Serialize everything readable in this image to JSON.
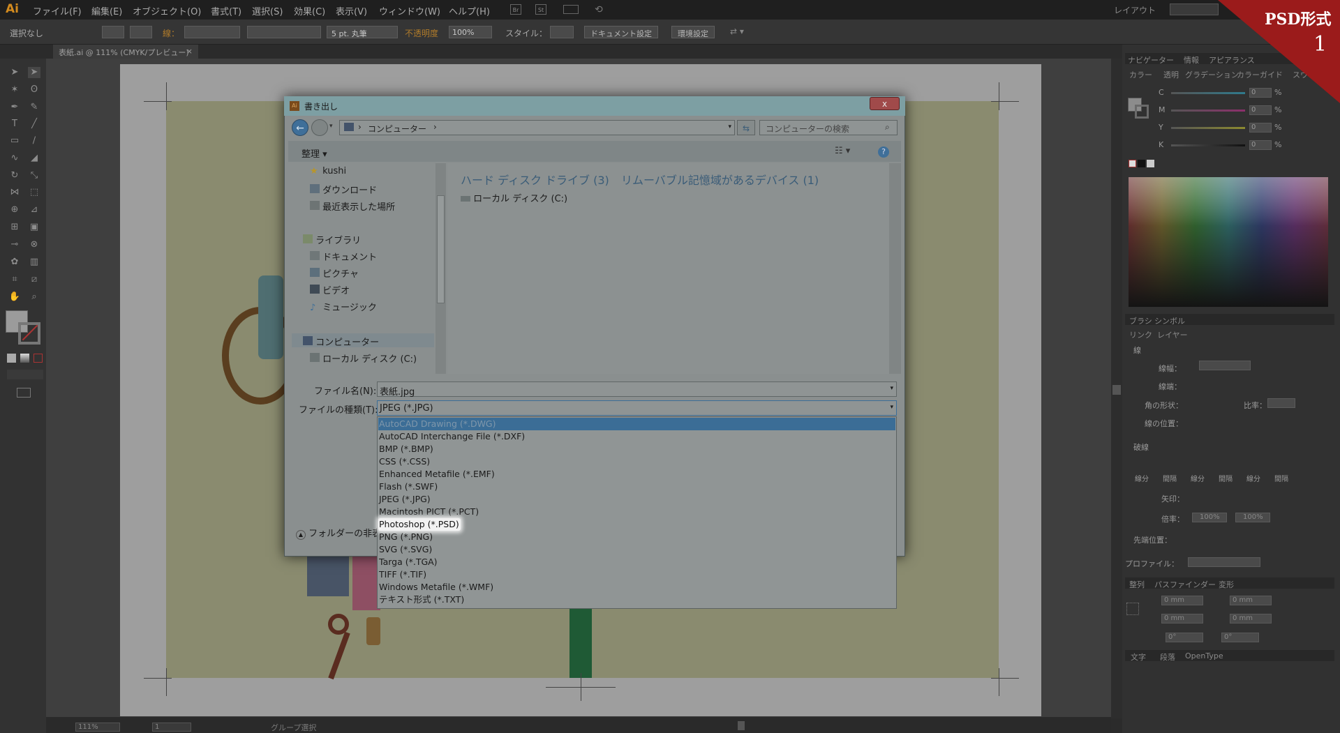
{
  "app": {
    "logo": "Ai",
    "menu": [
      "ファイル(F)",
      "編集(E)",
      "オブジェクト(O)",
      "書式(T)",
      "選択(S)",
      "効果(C)",
      "表示(V)",
      "ウィンドウ(W)",
      "ヘルプ(H)"
    ],
    "bridge_buttons": [
      "Br",
      "St"
    ],
    "workspace": "レイアウト",
    "search_placeholder": ""
  },
  "control_bar": {
    "selection": "選択なし",
    "stroke_label": "線：",
    "brush": "5 pt. 丸筆",
    "opacity_label": "不透明度",
    "opacity_value": "100%",
    "style_label": "スタイル：",
    "document_settings": "ドキュメント設定",
    "preferences": "環境設定"
  },
  "doc_tab": {
    "title": "表紙.ai @ 111% (CMYK/プレビュー)",
    "close": "×"
  },
  "status_bar": {
    "zoom": "111%",
    "page": "1",
    "tool": "グループ選択"
  },
  "corner_badge": {
    "title": "PSD形式",
    "step": "1",
    "color": "#9b1b1b"
  },
  "right_panel": {
    "tabs_top": [
      "ナビゲーター",
      "情報",
      "アピアランス"
    ],
    "tabs_color": [
      "カラー",
      "透明",
      "グラデーション",
      "カラーガイド",
      "スウォッチ"
    ],
    "cmyk": [
      {
        "label": "C",
        "value": "0",
        "unit": "%"
      },
      {
        "label": "M",
        "value": "0",
        "unit": "%"
      },
      {
        "label": "Y",
        "value": "0",
        "unit": "%"
      },
      {
        "label": "K",
        "value": "0",
        "unit": "%"
      }
    ],
    "tabs_brush": [
      "ブラシ",
      "シンボル"
    ],
    "tabs_layers": [
      "リンク",
      "レイヤー"
    ],
    "stroke_title": "線",
    "stroke_rows": [
      "線幅：",
      "線端：",
      "角の形状：",
      "線の位置："
    ],
    "miter_label": "比率：",
    "dash_title": "破線",
    "dash_labels": [
      "線分",
      "間隔",
      "線分",
      "間隔",
      "線分",
      "間隔"
    ],
    "arrow_label": "矢印：",
    "scale_label": "倍率：",
    "scale_values": [
      "100%",
      "100%"
    ],
    "align_label": "先端位置：",
    "profile_label": "プロファイル：",
    "tabs_transform": [
      "整列",
      "パスファインダー",
      "変形"
    ],
    "transform": {
      "x": "0 mm",
      "y": "0 mm",
      "w": "0 mm",
      "h": "0 mm",
      "angle": "0°",
      "shear": "0°"
    },
    "tabs_type": [
      "文字",
      "段落",
      "OpenType"
    ]
  },
  "dialog": {
    "title": "書き出し",
    "close": "x",
    "address": "コンピューター",
    "search_placeholder": "コンピューターの検索",
    "organize": "整理",
    "nav": {
      "favorites": [
        "kushi",
        "ダウンロード",
        "最近表示した場所"
      ],
      "library_title": "ライブラリ",
      "libraries": [
        "ドキュメント",
        "ピクチャ",
        "ビデオ",
        "ミュージック"
      ],
      "computer_title": "コンピューター",
      "drives": [
        "ローカル ディスク (C:)"
      ]
    },
    "groups": [
      "ハード ディスク ドライブ (3)",
      "リムーバブル記憶域があるデバイス (1)"
    ],
    "drive_item": "ローカル ディスク (C:)",
    "filename_label": "ファイル名(N):",
    "filename_value": "表紙.jpg",
    "filetype_label": "ファイルの種類(T):",
    "filetype_value": "JPEG (*.JPG)",
    "folder_toggle": "フォルダーの非表示",
    "filetypes": [
      "AutoCAD Drawing (*.DWG)",
      "AutoCAD Interchange File (*.DXF)",
      "BMP (*.BMP)",
      "CSS (*.CSS)",
      "Enhanced Metafile (*.EMF)",
      "Flash (*.SWF)",
      "JPEG (*.JPG)",
      "Macintosh PICT (*.PCT)",
      "Photoshop (*.PSD)",
      "PNG (*.PNG)",
      "SVG (*.SVG)",
      "Targa (*.TGA)",
      "TIFF (*.TIF)",
      "Windows Metafile (*.WMF)",
      "テキスト形式 (*.TXT)"
    ],
    "selected_index": 0,
    "highlighted_index": 8
  }
}
